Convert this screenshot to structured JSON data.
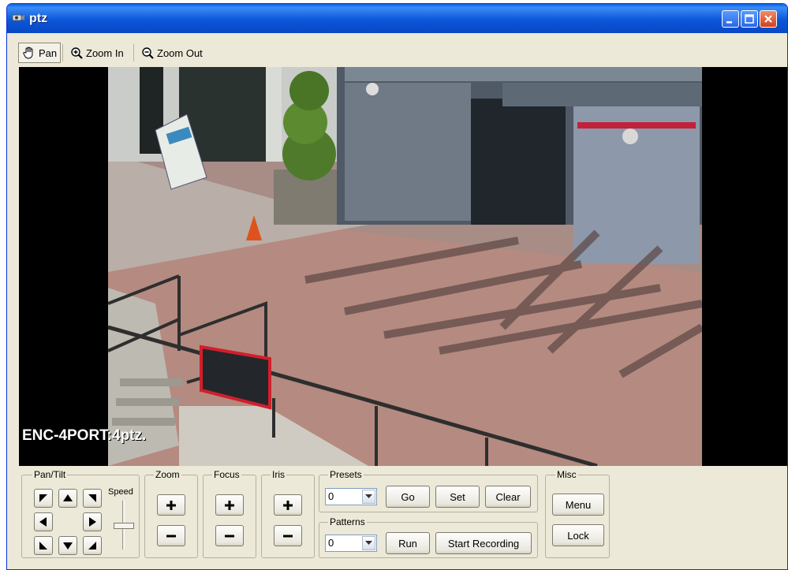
{
  "window": {
    "title": "ptz"
  },
  "toolbar": {
    "tools": [
      {
        "label": "Pan",
        "icon": "hand-icon",
        "active": true
      },
      {
        "label": "Zoom In",
        "icon": "zoom-in-icon"
      },
      {
        "label": "Zoom Out",
        "icon": "zoom-out-icon"
      }
    ]
  },
  "video": {
    "overlay_text": "ENC-4PORT:4ptz."
  },
  "controls": {
    "pan_tilt": {
      "label": "Pan/Tilt",
      "speed_label": "Speed"
    },
    "zoom": {
      "label": "Zoom"
    },
    "focus": {
      "label": "Focus"
    },
    "iris": {
      "label": "Iris"
    },
    "presets": {
      "label": "Presets",
      "value": "0",
      "go_label": "Go",
      "set_label": "Set",
      "clear_label": "Clear"
    },
    "patterns": {
      "label": "Patterns",
      "value": "0",
      "run_label": "Run",
      "record_label": "Start Recording"
    },
    "misc": {
      "label": "Misc",
      "menu_label": "Menu",
      "lock_label": "Lock"
    }
  },
  "colors": {
    "titlebar": "#0b56d8",
    "face": "#ece9d8",
    "close": "#d0421c"
  }
}
